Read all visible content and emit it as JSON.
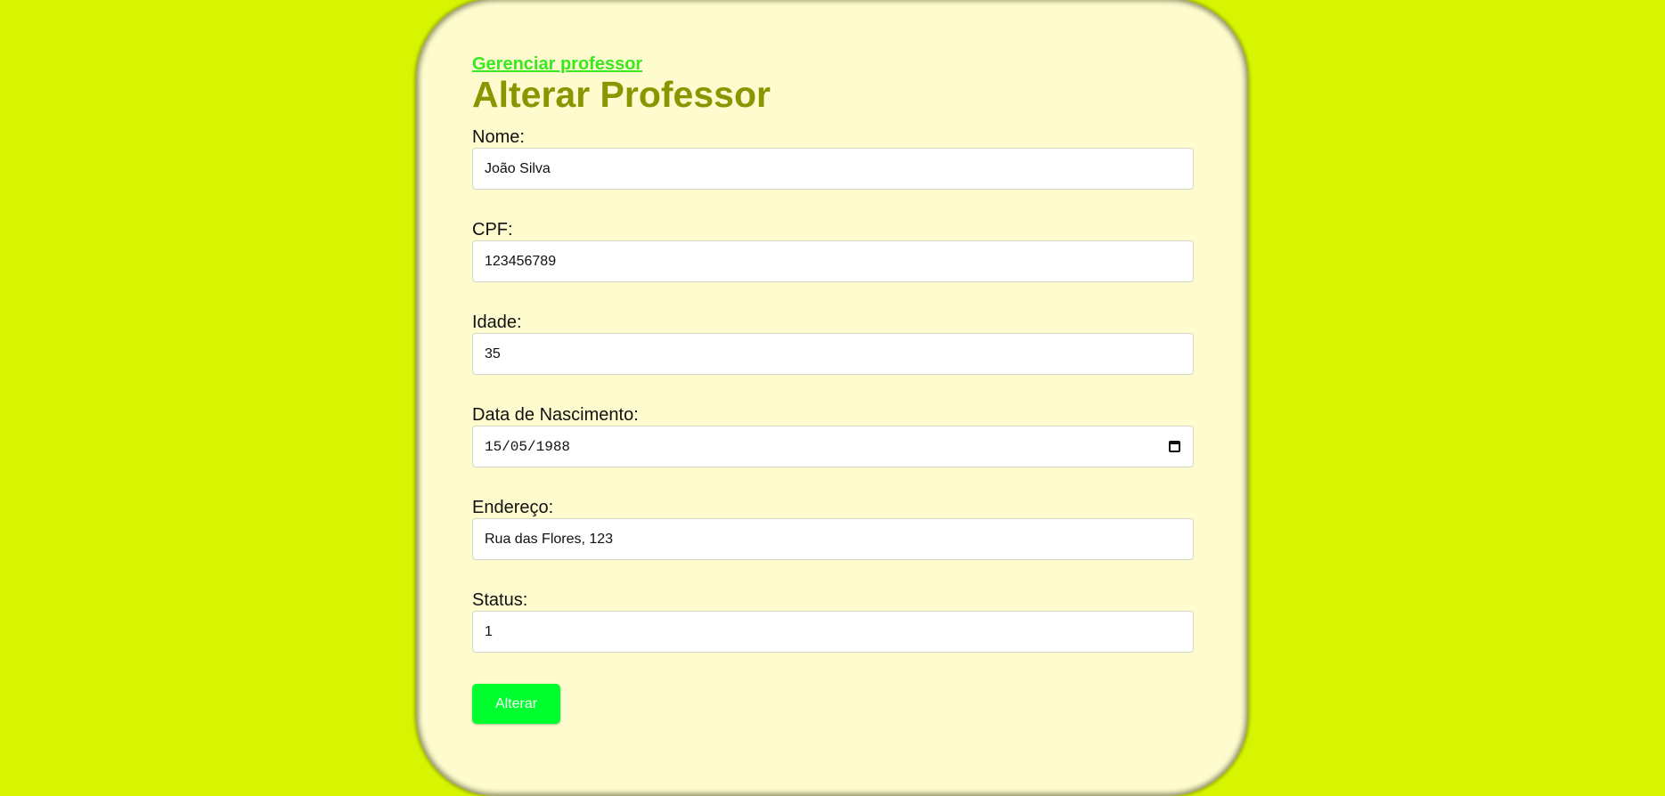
{
  "nav": {
    "back_link": "Gerenciar professor"
  },
  "page": {
    "title": "Alterar Professor"
  },
  "form": {
    "nome": {
      "label": "Nome:",
      "value": "João Silva"
    },
    "cpf": {
      "label": "CPF:",
      "value": "123456789"
    },
    "idade": {
      "label": "Idade:",
      "value": "35"
    },
    "nascimento": {
      "label": "Data de Nascimento:",
      "value": "15/05/1988"
    },
    "endereco": {
      "label": "Endereço:",
      "value": "Rua das Flores, 123"
    },
    "status": {
      "label": "Status:",
      "value": "1"
    },
    "submit_label": "Alterar"
  },
  "colors": {
    "background": "#d7f500",
    "card": "#fefcce",
    "link": "#39e81f",
    "title": "#8a9600",
    "button": "#00ff2e"
  },
  "icons": {
    "date_picker": "calendar-icon"
  }
}
